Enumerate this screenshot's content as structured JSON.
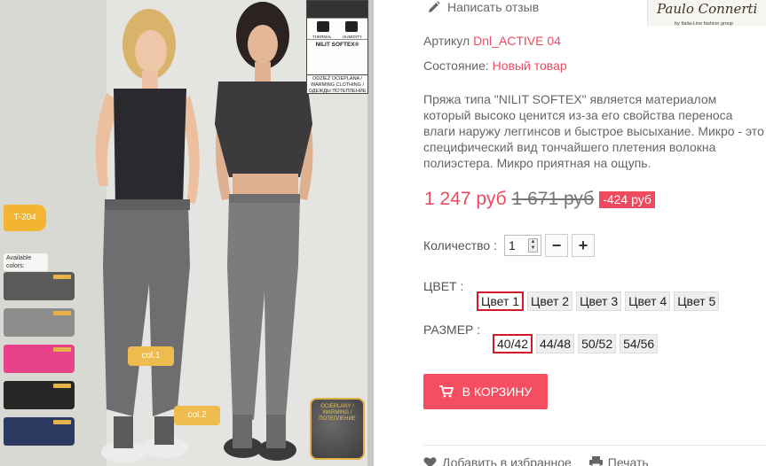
{
  "product_image": {
    "alt": "Product photo",
    "tag_model": "T-204",
    "available_colors_label": "Available colors:",
    "col1": "col.1",
    "col2": "col.2",
    "label_nilit": "NILIT SOFTEX®",
    "label_thermal": "THERMAL",
    "label_humidity": "HUMIDITY",
    "label_warming": "ODZIEŻ OCIEPLANA / WARMING CLOTHING / ОДЕЖДЫ ПОТЕПЛЕНИЕ",
    "fabric_text": "OCIEPLANY / WARMING / ПОТЕПЛЕНИЕ",
    "swatch_colors": [
      "#5a5a5a",
      "#8d8d8d",
      "#e8428a",
      "#262626",
      "#2c3a62"
    ]
  },
  "header": {
    "write_review": "Написать отзыв",
    "brand_name": "Paulo Connerti",
    "brand_sub": "by Italia-Line fashion group"
  },
  "meta": {
    "sku_label": "Артикул",
    "sku_value": "Dnl_ACTIVE 04",
    "condition_label": "Состояние:",
    "condition_value": "Новый товар"
  },
  "description": "Пряжа типа \"NILIT SOFTEX\" является материалом\nкоторый высоко ценится из-за его свойства переноса\nвлаги наружу леггинсов и быстрое высыхание. Микро - это\nспецифический вид тончайшего плетения волокна\nполиэстера. Микро приятная на ощупь.",
  "price": {
    "current": "1 247 руб",
    "old": "1 671 руб",
    "discount": "-424 руб"
  },
  "quantity": {
    "label": "Количество :",
    "value": "1",
    "minus": "−",
    "plus": "+"
  },
  "color": {
    "label": "ЦВЕТ :",
    "options": [
      "Цвет 1",
      "Цвет 2",
      "Цвет 3",
      "Цвет 4",
      "Цвет 5"
    ],
    "selected": "Цвет 1"
  },
  "size": {
    "label": "РАЗМЕР :",
    "options": [
      "40/42",
      "44/48",
      "50/52",
      "54/56"
    ],
    "selected": "40/42"
  },
  "cart_button": "В КОРЗИНУ",
  "bottom": {
    "wishlist": "Добавить в избранное",
    "print": "Печать"
  },
  "colors": {
    "accent": "#ed4a5f",
    "selected_border": "#d21b27"
  }
}
